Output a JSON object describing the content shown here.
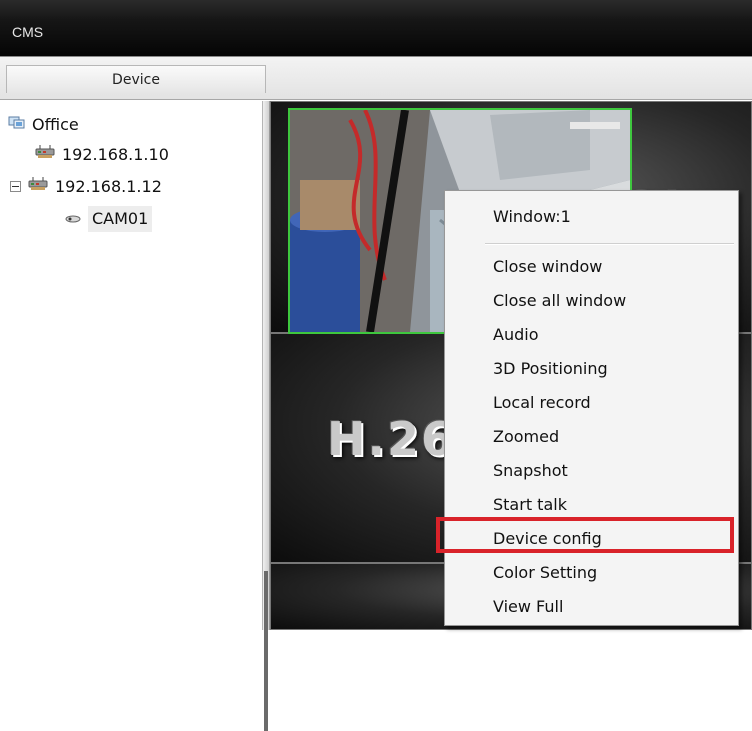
{
  "window": {
    "title": "CMS"
  },
  "tabs": {
    "device_label": "Device"
  },
  "tree": {
    "root": {
      "label": "Office",
      "icon": "group-icon"
    },
    "devices": [
      {
        "label": "192.168.1.10",
        "icon": "network-device-icon",
        "expanded": false
      },
      {
        "label": "192.168.1.12",
        "icon": "network-device-icon",
        "expanded": true
      }
    ],
    "camera": {
      "label": "CAM01",
      "icon": "camera-icon",
      "selected": true
    }
  },
  "video_grid": {
    "placeholder_text": "H.264",
    "active_window": 1
  },
  "context_menu": {
    "header": "Window:1",
    "items": [
      "Close window",
      "Close all window",
      "Audio",
      "3D Positioning",
      "Local record",
      "Zoomed",
      "Snapshot",
      "Start talk",
      "Device config",
      "Color Setting",
      "View Full"
    ],
    "highlighted_item": "Device config",
    "highlight_color": "#d9232a"
  },
  "colors": {
    "active_window_border": "#3ec73e",
    "titlebar": "#050505"
  }
}
